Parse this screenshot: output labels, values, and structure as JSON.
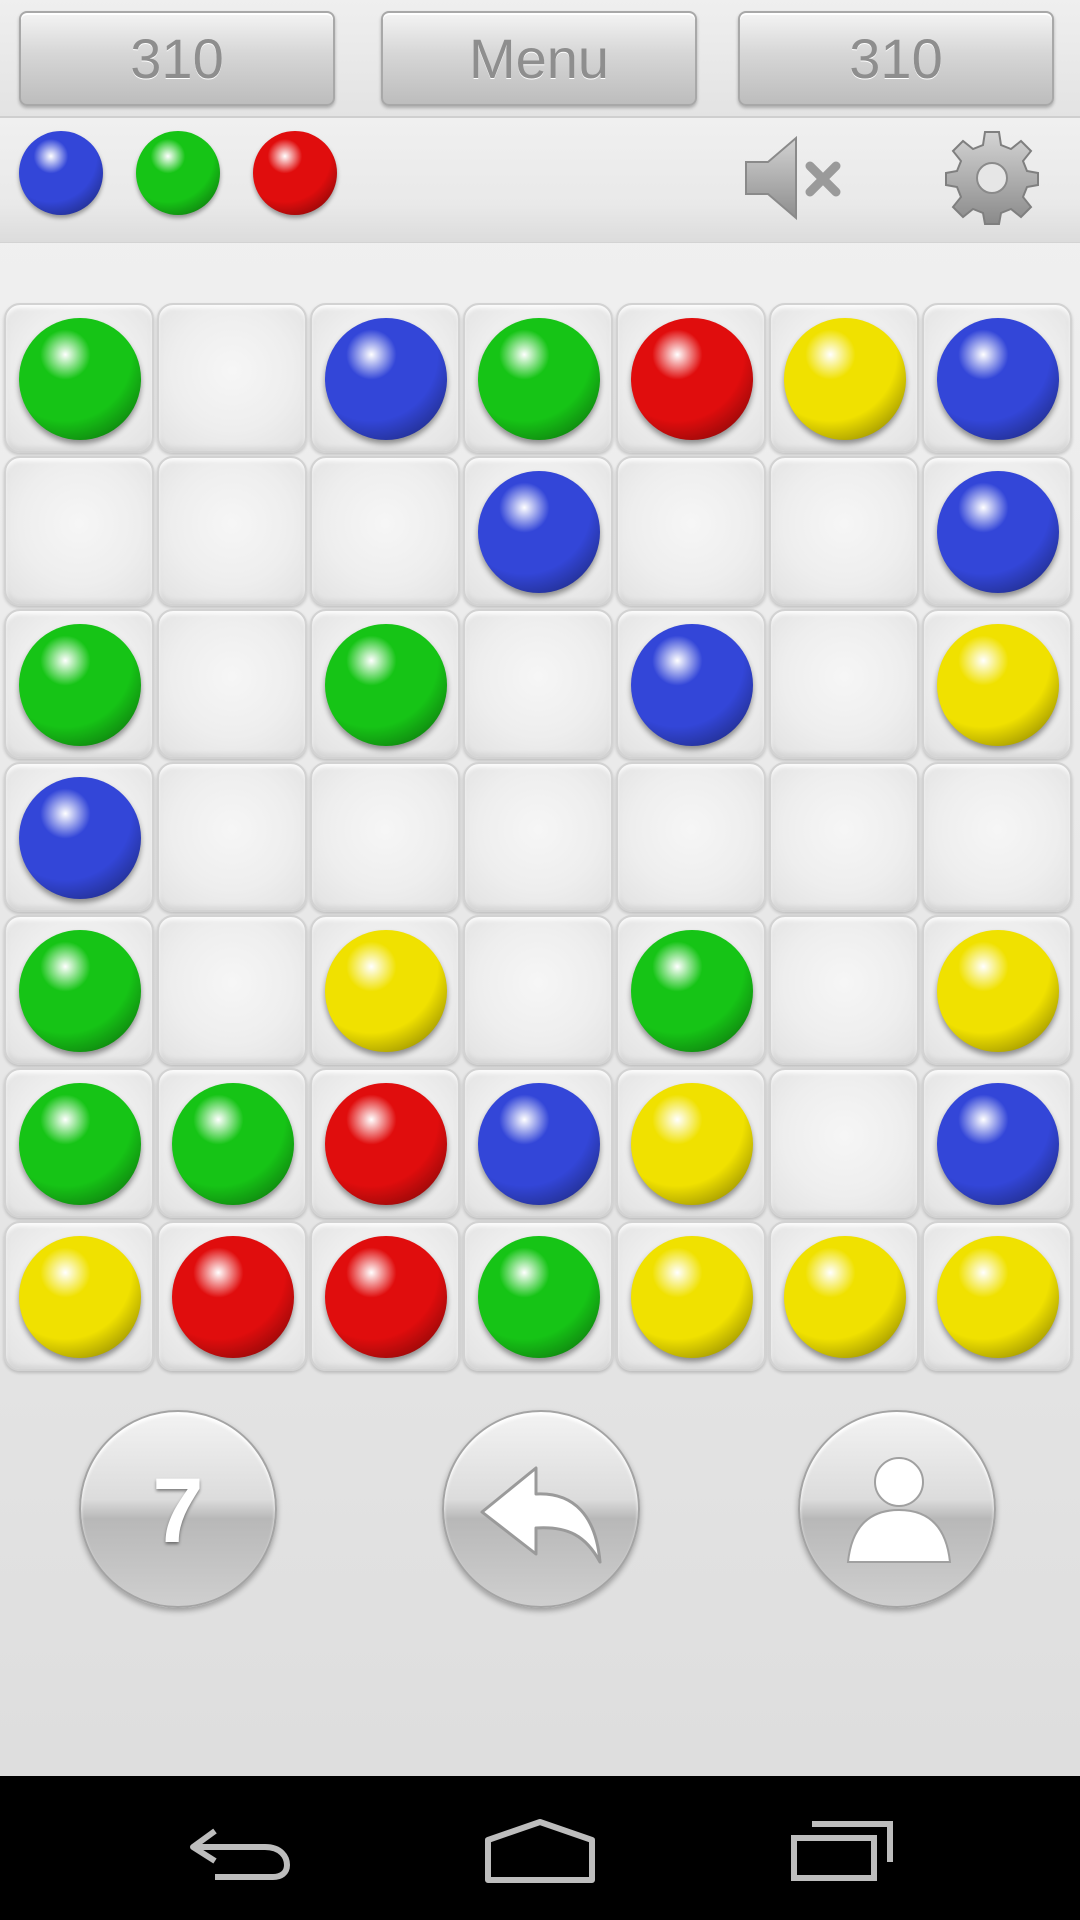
{
  "topbar": {
    "left_score": "310",
    "menu_label": "Menu",
    "right_score": "310"
  },
  "next_balls": [
    "blue",
    "green",
    "red"
  ],
  "icons": {
    "sound": "speaker-muted-icon",
    "settings": "gear-icon",
    "undo": "undo-arrow-icon",
    "profile": "person-icon",
    "nav_back": "back-icon",
    "nav_home": "home-icon",
    "nav_recents": "recents-icon"
  },
  "colors": {
    "green": "#16c416",
    "blue": "#3346d8",
    "red": "#e00d0d",
    "yellow": "#f0e100"
  },
  "board": {
    "columns": 7,
    "rows": [
      [
        "green",
        "",
        "blue",
        "green",
        "red",
        "yellow",
        "blue"
      ],
      [
        "",
        "",
        "",
        "blue",
        "",
        "",
        "blue"
      ],
      [
        "green",
        "",
        "green",
        "",
        "blue",
        "",
        "yellow"
      ],
      [
        "blue",
        "",
        "",
        "",
        "",
        "",
        ""
      ],
      [
        "green",
        "",
        "yellow",
        "",
        "green",
        "",
        "yellow"
      ],
      [
        "green",
        "green",
        "red",
        "blue",
        "yellow",
        "",
        "blue"
      ],
      [
        "yellow",
        "red",
        "red",
        "green",
        "yellow",
        "yellow",
        "yellow"
      ]
    ]
  },
  "bottom": {
    "count_label": "7"
  }
}
